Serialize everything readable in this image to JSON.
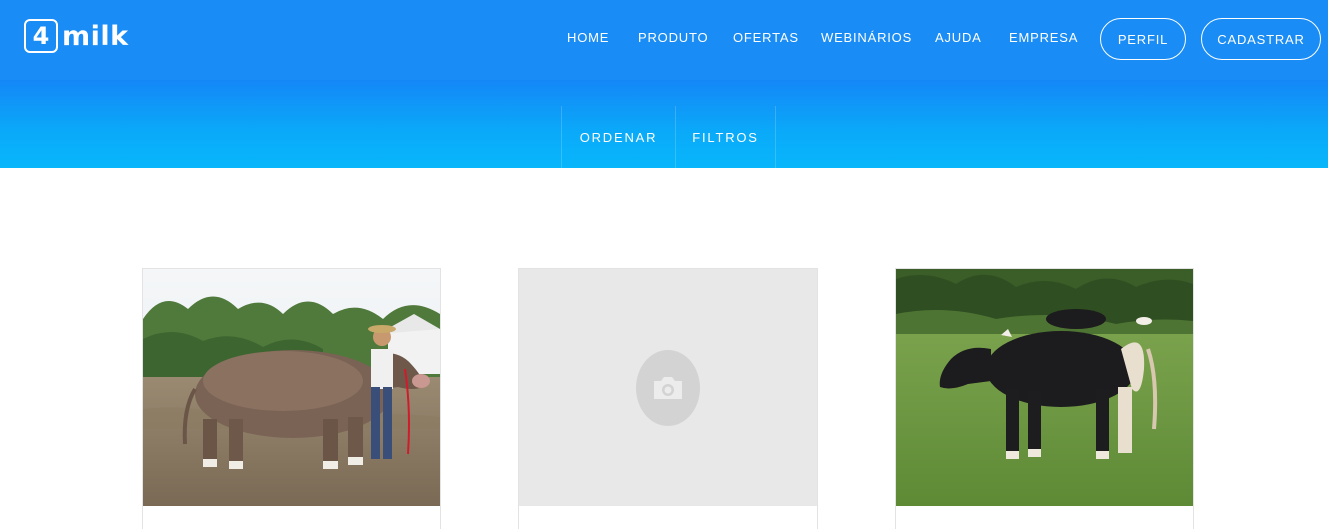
{
  "brand": {
    "logo_mark": "4",
    "logo_text": "milk"
  },
  "nav": {
    "links": [
      "HOME",
      "PRODUTO",
      "OFERTAS",
      "WEBINÁRIOS",
      "AJUDA",
      "EMPRESA"
    ],
    "profile_label": "PERFIL",
    "register_label": "CADASTRAR"
  },
  "subbar": {
    "sort_label": "ORDENAR",
    "filter_label": "FILTROS"
  },
  "cards": [
    {
      "image": "brown-bull-photo",
      "has_photo": true
    },
    {
      "image": "camera-icon",
      "has_photo": false
    },
    {
      "image": "black-bull-photo",
      "has_photo": true
    }
  ],
  "colors": {
    "header_blue": "#1a8cf5",
    "subbar_gradient_end": "#08b6fb",
    "placeholder_gray": "#e8e8e8"
  }
}
